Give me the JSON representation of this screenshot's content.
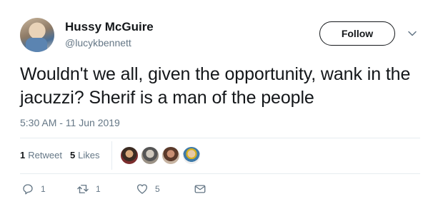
{
  "author": {
    "name": "Hussy McGuire",
    "handle": "@lucykbennett"
  },
  "follow_button": {
    "label": "Follow"
  },
  "tweet": {
    "text": "Wouldn't we all, given the opportunity, wank in the jacuzzi? Sherif is a man of the people",
    "timestamp": "5:30 AM - 11 Jun 2019"
  },
  "stats": {
    "retweets_count": "1",
    "retweets_label": "Retweet",
    "likes_count": "5",
    "likes_label": "Likes"
  },
  "actions": {
    "reply_count": "1",
    "retweet_count": "1",
    "like_count": "5"
  },
  "colors": {
    "text": "#14171a",
    "secondary": "#657786",
    "divider": "#e6ecf0"
  }
}
